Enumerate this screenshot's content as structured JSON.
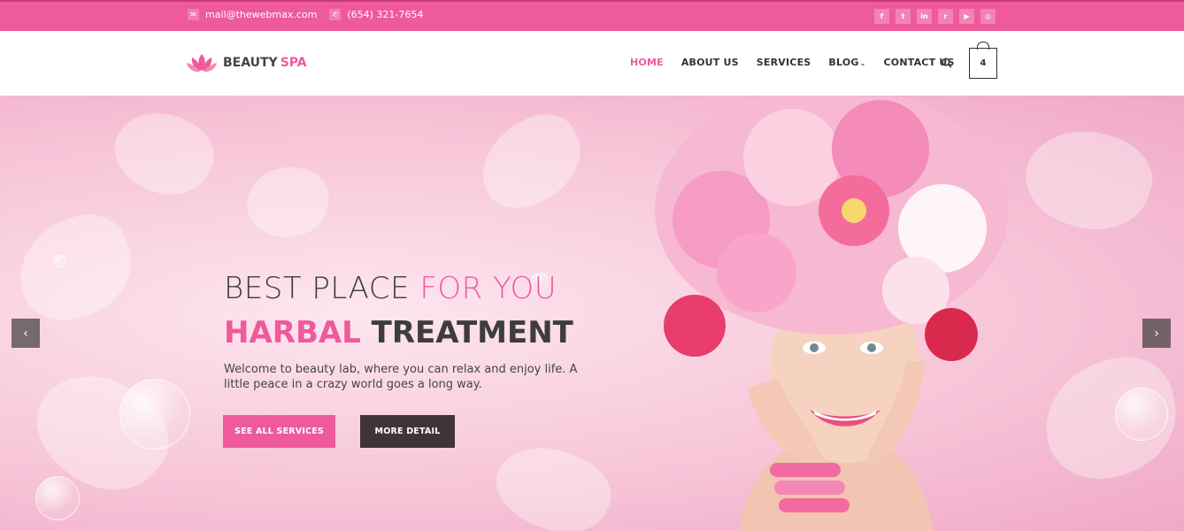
{
  "topbar": {
    "email": "mail@thewebmax.com",
    "phone": "(654) 321-7654",
    "email_icon": "envelope-icon",
    "phone_icon": "phone-icon",
    "social": [
      {
        "icon": "facebook-icon",
        "glyph": "f"
      },
      {
        "icon": "twitter-icon",
        "glyph": "t"
      },
      {
        "icon": "linkedin-icon",
        "glyph": "in"
      },
      {
        "icon": "rss-icon",
        "glyph": "r"
      },
      {
        "icon": "youtube-icon",
        "glyph": "▶"
      },
      {
        "icon": "instagram-icon",
        "glyph": "◎"
      }
    ]
  },
  "header": {
    "logo_text_1": "BEAUTY",
    "logo_text_2": "SPA",
    "nav": [
      {
        "label": "HOME",
        "active": true
      },
      {
        "label": "ABOUT US",
        "active": false
      },
      {
        "label": "SERVICES",
        "active": false
      },
      {
        "label": "BLOG",
        "active": false,
        "caret": "⌄"
      },
      {
        "label": "CONTACT US",
        "active": false
      }
    ],
    "cart_count": "4"
  },
  "hero": {
    "line1_a": "BEST PLACE ",
    "line1_b": "FOR YOU",
    "line2_a": "HARBAL",
    "line2_b": " TREATMENT",
    "description": "Welcome to beauty lab, where you can relax and enjoy life. A little peace in a crazy world goes a long way.",
    "button_primary": "SEE ALL SERVICES",
    "button_secondary": "MORE DETAIL",
    "prev_arrow": "‹",
    "next_arrow": "›"
  },
  "colors": {
    "brand_pink": "#ee5a9b",
    "dark": "#3f3539"
  }
}
